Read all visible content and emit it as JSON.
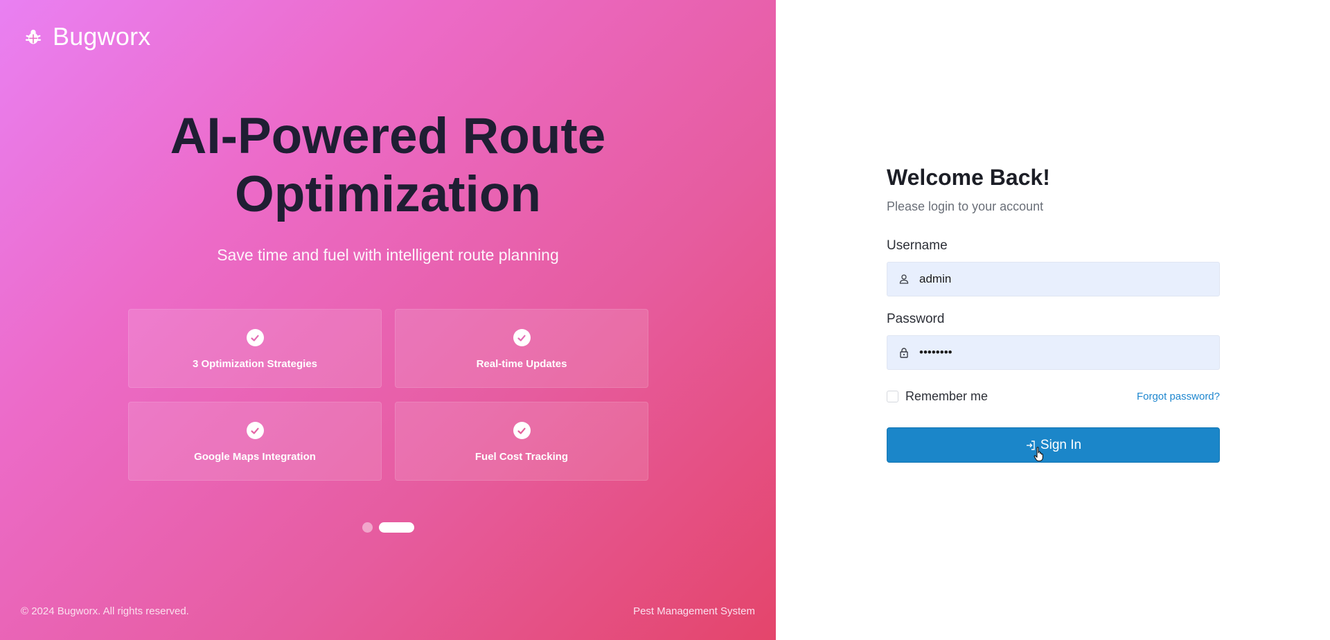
{
  "brand": {
    "name": "Bugworx",
    "icon": "bug-icon"
  },
  "hero": {
    "title_line1": "AI-Powered Route",
    "title_line2": "Optimization",
    "subtitle": "Save time and fuel with intelligent route planning"
  },
  "features": [
    {
      "label": "3 Optimization Strategies",
      "icon": "check-circle-icon"
    },
    {
      "label": "Real-time Updates",
      "icon": "check-circle-icon"
    },
    {
      "label": "Google Maps Integration",
      "icon": "check-circle-icon"
    },
    {
      "label": "Fuel Cost Tracking",
      "icon": "check-circle-icon"
    }
  ],
  "carousel": {
    "slides": 2,
    "active_index": 1
  },
  "footer": {
    "copyright": "© 2024 Bugworx. All rights reserved.",
    "tagline": "Pest Management System"
  },
  "login": {
    "title": "Welcome Back!",
    "subtitle": "Please login to your account",
    "username_label": "Username",
    "username_value": "admin",
    "password_label": "Password",
    "password_value": "••••••••",
    "remember_label": "Remember me",
    "remember_checked": false,
    "forgot_label": "Forgot password?",
    "signin_label": "Sign In"
  },
  "colors": {
    "gradient_start": "#e980f2",
    "gradient_end": "#e4456b",
    "primary_button": "#1b86c9",
    "input_bg": "#e8effd",
    "link": "#1f87cf"
  }
}
